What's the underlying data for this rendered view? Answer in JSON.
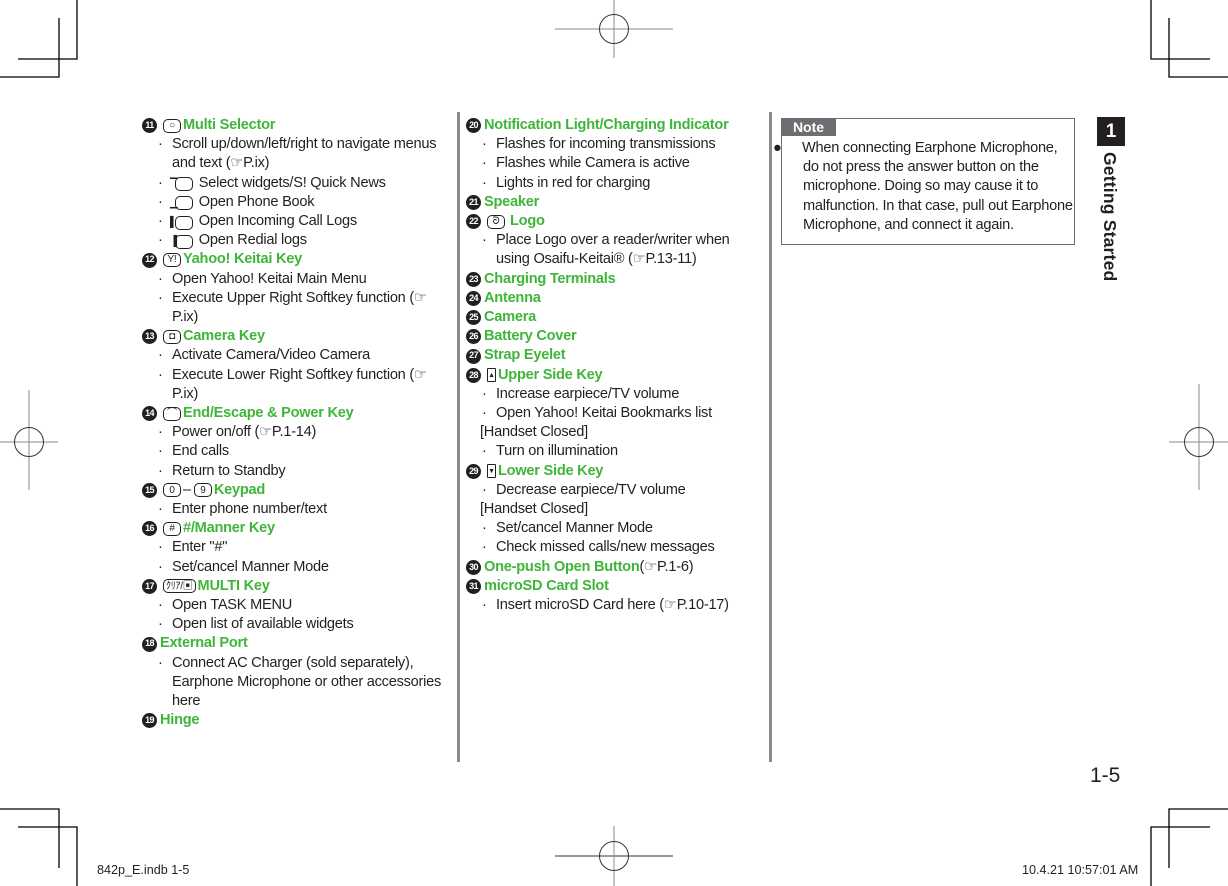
{
  "chapter": {
    "number": "1",
    "title": "Getting Started"
  },
  "page_number": "1-5",
  "slug": {
    "file": "842p_E.indb   1-5",
    "timestamp": "10.4.21   10:57:01 AM"
  },
  "colors": {
    "accent_green": "#3fb53a",
    "text": "#231f20",
    "note_gray": "#6d6e71",
    "divider": "#8a8a8a"
  },
  "column1": [
    {
      "num": "11",
      "icon": "multi-selector-icon",
      "icon_glyph": "○",
      "title": "Multi Selector",
      "bullets": [
        {
          "text": "Scroll up/down/left/right to navigate menus and text (☞P.ix)"
        },
        {
          "icon": "selector-up-icon",
          "icon_glyph": "▔",
          "text": "Select widgets/S! Quick News"
        },
        {
          "icon": "selector-down-icon",
          "icon_glyph": "▁",
          "text": "Open Phone Book"
        },
        {
          "icon": "selector-left-icon",
          "icon_glyph": "▌",
          "text": "Open Incoming Call Logs"
        },
        {
          "icon": "selector-right-icon",
          "icon_glyph": "▐",
          "text": "Open Redial logs"
        }
      ]
    },
    {
      "num": "12",
      "icon": "yahoo-key-icon",
      "icon_glyph": "Y!",
      "title": "Yahoo! Keitai Key",
      "bullets": [
        {
          "text": "Open Yahoo! Keitai Main Menu"
        },
        {
          "text": "Execute Upper Right Softkey function (☞P.ix)"
        }
      ]
    },
    {
      "num": "13",
      "icon": "camera-key-icon",
      "icon_glyph": "◘",
      "title": "Camera Key",
      "bullets": [
        {
          "text": "Activate Camera/Video Camera"
        },
        {
          "text": "Execute Lower Right Softkey function (☞P.ix)"
        }
      ]
    },
    {
      "num": "14",
      "icon": "end-key-icon",
      "icon_glyph": "⌒",
      "title": "End/Escape & Power Key",
      "bullets": [
        {
          "text": "Power on/off (☞P.1-14)"
        },
        {
          "text": "End calls"
        },
        {
          "text": "Return to Standby"
        }
      ]
    },
    {
      "num": "15",
      "icon": "key-0-icon",
      "icon_glyph": "0",
      "icon2": "key-9-icon",
      "icon2_glyph": "9",
      "range_sep": "–",
      "title": "Keypad",
      "bullets": [
        {
          "text": "Enter phone number/text"
        }
      ]
    },
    {
      "num": "16",
      "icon": "hash-key-icon",
      "icon_glyph": "#",
      "title": "#/Manner Key",
      "bullets": [
        {
          "text": "Enter \"#\""
        },
        {
          "text": "Set/cancel Manner Mode"
        }
      ]
    },
    {
      "num": "17",
      "icon": "multi-key-icon",
      "icon_glyph": "ｸﾘｱ/▣",
      "title": "MULTI Key",
      "bullets": [
        {
          "text": "Open TASK MENU"
        },
        {
          "text": "Open list of available widgets"
        }
      ]
    },
    {
      "num": "18",
      "title": "External Port",
      "bullets": [
        {
          "text": "Connect AC Charger (sold separately), Earphone Microphone or other accessories here"
        }
      ]
    },
    {
      "num": "19",
      "title": "Hinge",
      "bullets": []
    }
  ],
  "column2": [
    {
      "num": "20",
      "title": "Notification Light/Charging Indicator",
      "bullets": [
        {
          "text": "Flashes for incoming transmissions"
        },
        {
          "text": "Flashes while Camera is active"
        },
        {
          "text": "Lights in red for charging"
        }
      ]
    },
    {
      "num": "21",
      "title": "Speaker",
      "bullets": []
    },
    {
      "num": "22",
      "icon": "felica-logo-icon",
      "icon_glyph": "ᘐ",
      "title": "Logo",
      "bullets": [
        {
          "text": "Place Logo over a reader/writer when using Osaifu-Keitai® (☞P.13-11)"
        }
      ]
    },
    {
      "num": "23",
      "title": "Charging Terminals",
      "bullets": []
    },
    {
      "num": "24",
      "title": "Antenna",
      "bullets": []
    },
    {
      "num": "25",
      "title": "Camera",
      "bullets": []
    },
    {
      "num": "26",
      "title": "Battery Cover",
      "bullets": []
    },
    {
      "num": "27",
      "title": "Strap Eyelet",
      "bullets": []
    },
    {
      "num": "28",
      "icon": "upper-side-key-icon",
      "icon_glyph": "▲",
      "title": "Upper Side Key",
      "bullets": [
        {
          "text": "Increase earpiece/TV volume"
        },
        {
          "text": "Open Yahoo! Keitai Bookmarks list"
        }
      ],
      "subsection": {
        "label": "[Handset Closed]",
        "bullets": [
          {
            "text": "Turn on illumination"
          }
        ]
      }
    },
    {
      "num": "29",
      "icon": "lower-side-key-icon",
      "icon_glyph": "▼",
      "title": "Lower Side Key",
      "bullets": [
        {
          "text": "Decrease earpiece/TV volume"
        }
      ],
      "subsection": {
        "label": "[Handset Closed]",
        "bullets": [
          {
            "text": "Set/cancel Manner Mode"
          },
          {
            "text": "Check missed calls/new messages"
          }
        ]
      }
    },
    {
      "num": "30",
      "title": "One-push Open Button",
      "ref": " (☞P.1-6)",
      "bullets": []
    },
    {
      "num": "31",
      "title": "microSD Card Slot",
      "bullets": [
        {
          "text": "Insert microSD Card here (☞P.10-17)"
        }
      ]
    }
  ],
  "note": {
    "label": "Note",
    "items": [
      "When connecting Earphone Microphone, do not press the answer button on the microphone. Doing so may cause it to malfunction. In that case, pull out Earphone Microphone, and connect it again."
    ]
  }
}
